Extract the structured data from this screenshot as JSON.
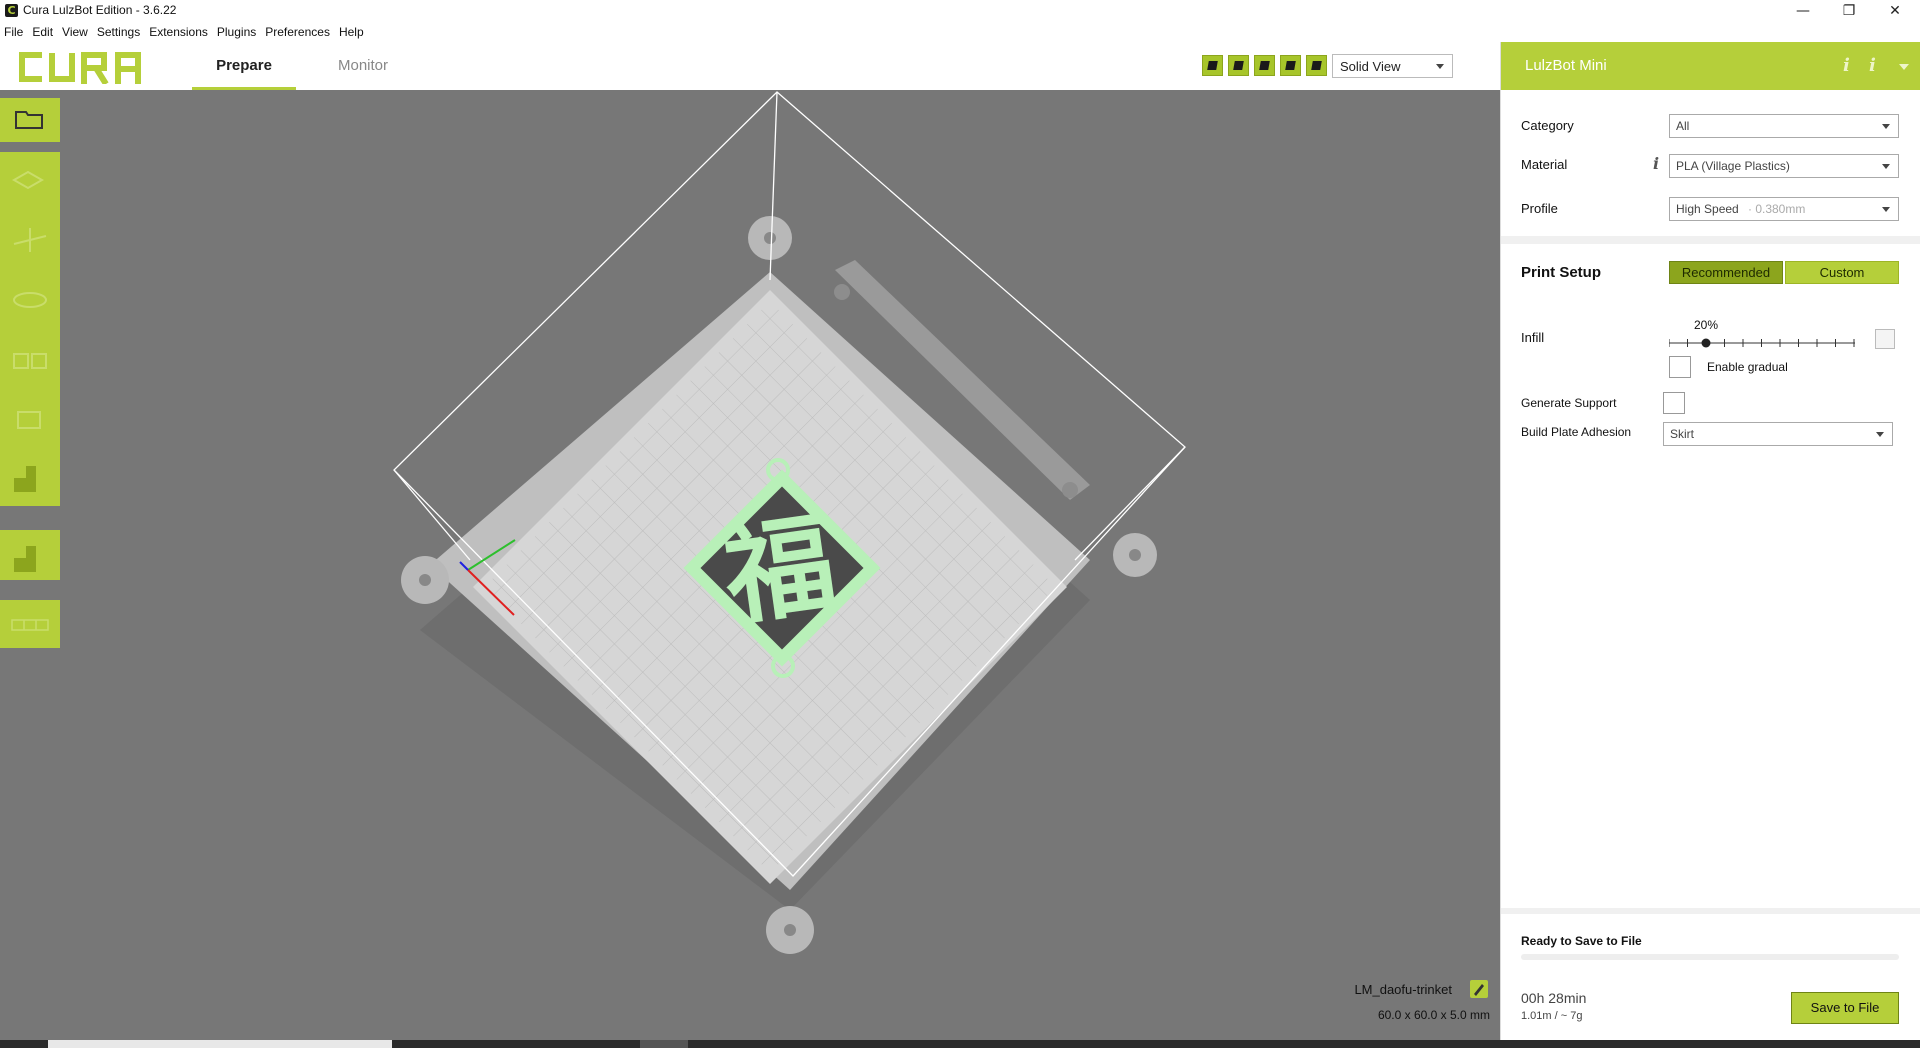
{
  "window": {
    "title": "Cura LulzBot Edition - 3.6.22",
    "app_icon_letter": "C",
    "minimize": "—",
    "restore": "❐",
    "close": "✕"
  },
  "menu": [
    "File",
    "Edit",
    "View",
    "Settings",
    "Extensions",
    "Plugins",
    "Preferences",
    "Help"
  ],
  "header": {
    "logo": "CURA",
    "tabs": [
      {
        "label": "Prepare",
        "active": true
      },
      {
        "label": "Monitor",
        "active": false
      }
    ],
    "view_buttons": [
      "3d-view-icon",
      "front-view-icon",
      "top-view-icon",
      "left-view-icon",
      "right-view-icon",
      "x-ray-view-icon"
    ],
    "view_mode": "Solid View"
  },
  "toolbar": {
    "items": [
      "open-file-icon",
      "move-icon",
      "translate-icon",
      "scale-icon",
      "mirror-icon",
      "rotate-icon",
      "support-blocker-icon",
      "per-model-settings-icon",
      "multiply-icon"
    ]
  },
  "viewport": {
    "model_name": "LM_daofu-trinket",
    "dimensions": "60.0 x 60.0 x 5.0 mm",
    "model_color": "#b8f0b8",
    "model_glyph": "福"
  },
  "panel": {
    "printer": "LulzBot Mini",
    "category_label": "Category",
    "category_value": "All",
    "material_label": "Material",
    "material_value": "PLA (Village Plastics)",
    "profile_label": "Profile",
    "profile_value": "High Speed",
    "profile_layer": "· 0.380mm",
    "print_setup_label": "Print Setup",
    "recommended": "Recommended",
    "custom": "Custom",
    "infill_label": "Infill",
    "infill_value": "20%",
    "infill_fraction": 0.2,
    "enable_gradual": "Enable gradual",
    "generate_support": "Generate Support",
    "build_plate_label": "Build Plate Adhesion",
    "build_plate_value": "Skirt",
    "ready": "Ready to Save to File",
    "time": "00h 28min",
    "usage": "1.01m / ~ 7g",
    "save": "Save to File"
  },
  "colors": {
    "accent": "#b5cf3a",
    "accent_dark": "#8ca51d",
    "viewport_bg": "#777777"
  }
}
